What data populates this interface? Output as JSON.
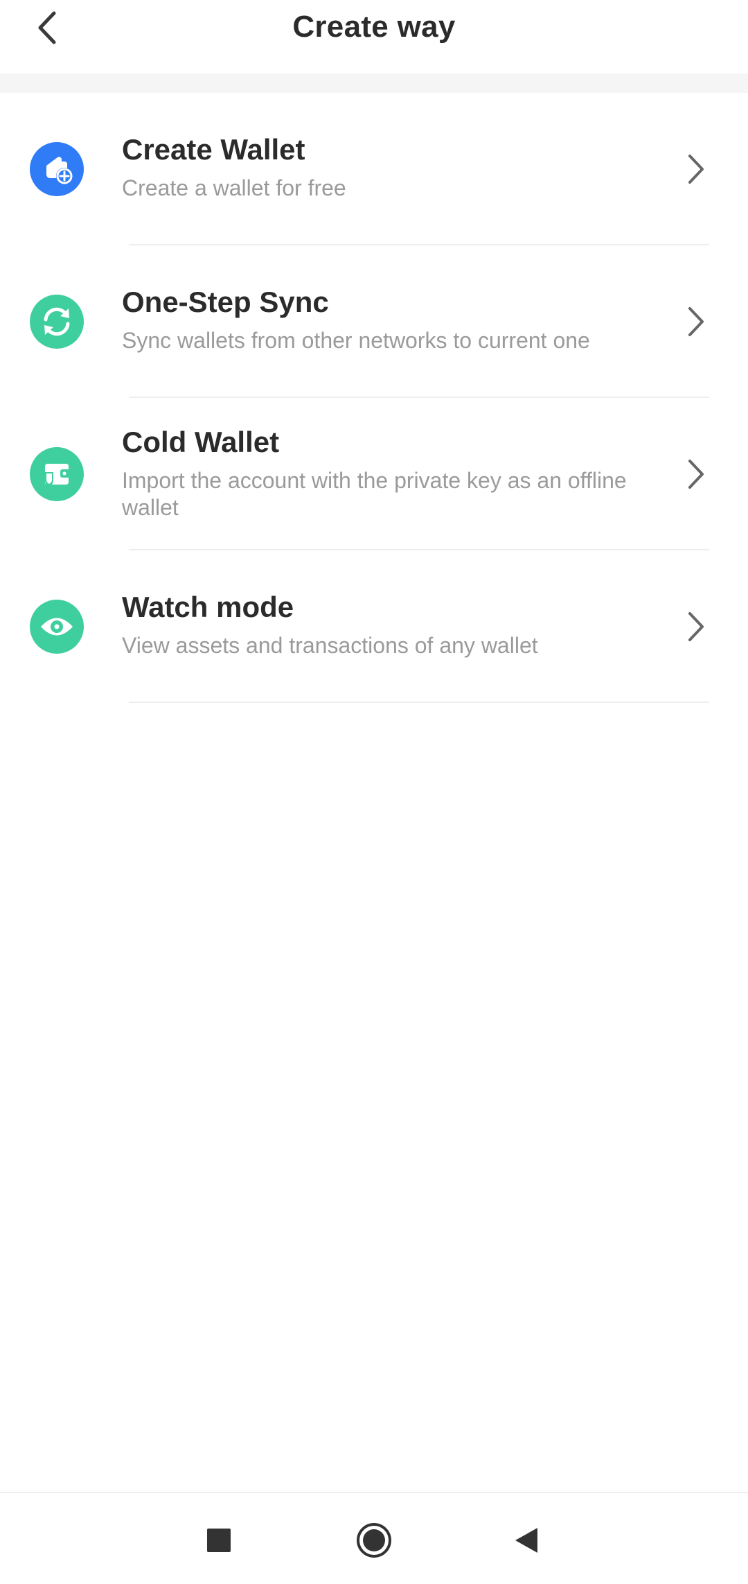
{
  "header": {
    "title": "Create way"
  },
  "options": [
    {
      "title": "Create Wallet",
      "subtitle": "Create a wallet for free",
      "icon": "wallet-add-icon",
      "icon_color": "#2f7cf6"
    },
    {
      "title": "One-Step Sync",
      "subtitle": "Sync wallets from other networks to current one",
      "icon": "sync-icon",
      "icon_color": "#3fcf9f"
    },
    {
      "title": "Cold Wallet",
      "subtitle": "Import the account with the private key as an offline wallet",
      "icon": "cold-wallet-shield-icon",
      "icon_color": "#3fcf9f"
    },
    {
      "title": "Watch mode",
      "subtitle": "View assets and transactions of any wallet",
      "icon": "eye-icon",
      "icon_color": "#3fcf9f"
    }
  ],
  "system_nav": {
    "recents": "square-icon",
    "home": "circle-icon",
    "back": "triangle-back-icon"
  }
}
